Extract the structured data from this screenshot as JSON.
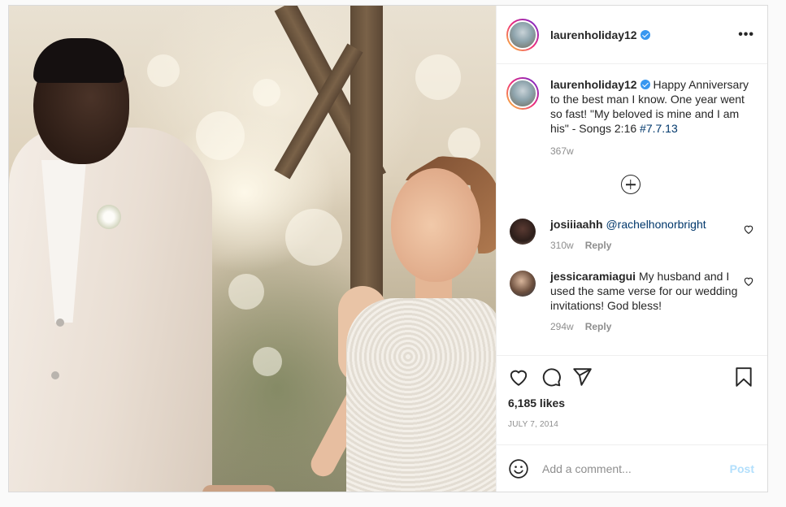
{
  "post": {
    "username": "laurenholiday12",
    "verified": true,
    "more_label": "•••",
    "caption": {
      "username": "laurenholiday12",
      "text": "Happy Anniversary to the best man I know. One year went so fast! \"My beloved is mine and I am his\" - Songs 2:16 ",
      "hashtag": "#7.7.13",
      "time": "367w"
    },
    "comments": [
      {
        "username": "josiiiaahh",
        "mention": "@rachelhonorbright",
        "text": "",
        "time": "310w",
        "reply_label": "Reply"
      },
      {
        "username": "jessicaramiagui",
        "mention": "",
        "text": "My husband and I used the same verse for our wedding invitations! God bless!",
        "time": "294w",
        "reply_label": "Reply"
      }
    ],
    "likes": "6,185 likes",
    "date": "JULY 7, 2014",
    "add_comment": {
      "placeholder": "Add a comment...",
      "post_label": "Post"
    }
  },
  "colors": {
    "link": "#00376b",
    "verified": "#3897f0",
    "post_button_disabled": "#b2dffc"
  },
  "icons": [
    "more-icon",
    "verified-badge-icon",
    "load-more-icon",
    "heart-icon",
    "comment-icon",
    "share-icon",
    "bookmark-icon",
    "emoji-icon"
  ]
}
